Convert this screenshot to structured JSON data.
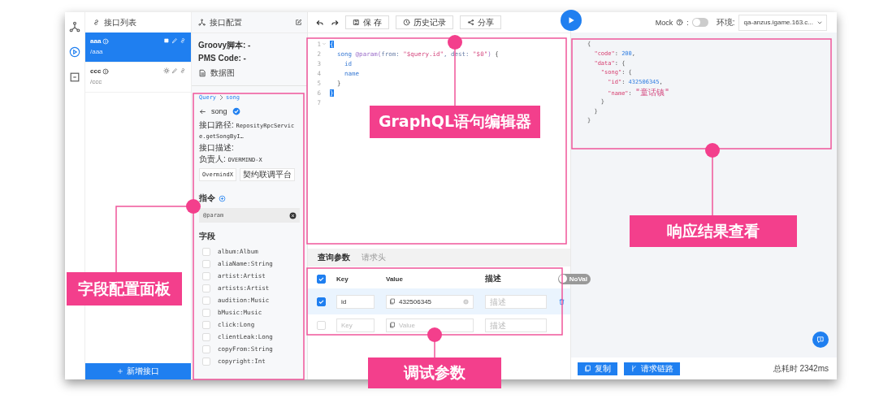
{
  "nav_rail": {
    "items": [
      {
        "kind": "graph",
        "selected": false
      },
      {
        "kind": "play",
        "selected": true
      },
      {
        "kind": "doc",
        "selected": false
      }
    ]
  },
  "interface_list": {
    "title": "接口列表",
    "items": [
      {
        "name": "aaa",
        "path": "/aaa",
        "kind": "square",
        "selected": true
      },
      {
        "name": "ccc",
        "path": "/ccc",
        "kind": "bug",
        "selected": false
      }
    ],
    "add_button": "新增接口"
  },
  "config_panel": {
    "title": "接口配置",
    "info_lines": [
      "Groovy脚本: -",
      "PMS Code: -"
    ],
    "data_graph": "数据图"
  },
  "field_panel": {
    "breadcrumb": [
      "Query",
      "song"
    ],
    "type_name": "song",
    "info": [
      {
        "label": "接口路径:",
        "value": "ReposityRpcService.getSongByI…"
      },
      {
        "label": "接口描述:"
      },
      {
        "label": "负责人:",
        "value": "OVERMIND-X"
      }
    ],
    "tags": [
      "OvermindX",
      "契约联调平台"
    ],
    "directives_title": "指令",
    "directive": "@param",
    "fields_title": "字段",
    "fields": [
      {
        "name": "album:Album",
        "checked": false
      },
      {
        "name": "aliaName:String",
        "checked": false
      },
      {
        "name": "artist:Artist",
        "checked": false
      },
      {
        "name": "artists:Artist",
        "checked": false
      },
      {
        "name": "audition:Music",
        "checked": false
      },
      {
        "name": "bMusic:Music",
        "checked": false
      },
      {
        "name": "click:Long",
        "checked": false
      },
      {
        "name": "clientLeak:Long",
        "checked": false
      },
      {
        "name": "copyFrom:String",
        "checked": false
      },
      {
        "name": "copyright:Int",
        "checked": false
      }
    ]
  },
  "toolbar": {
    "buttons": [
      {
        "kind": "save",
        "label": "保 存"
      },
      {
        "kind": "history",
        "label": "历史记录"
      },
      {
        "kind": "share",
        "label": "分享"
      }
    ]
  },
  "editor": {
    "lines": [
      {
        "number": "1",
        "fold": true,
        "tokens": [
          {
            "kind": "bracket",
            "text": "{"
          }
        ]
      },
      {
        "number": "2",
        "fold": false,
        "tokens": [
          {
            "kind": "field",
            "text": "  song "
          },
          {
            "kind": "directive",
            "text": "@param("
          },
          {
            "kind": "argument",
            "text": "from: "
          },
          {
            "kind": "string",
            "text": "\"$query.id\""
          },
          {
            "kind": "argument",
            "text": ", dest: "
          },
          {
            "kind": "string",
            "text": "\"$0\""
          },
          {
            "kind": "directive",
            "text": ") "
          },
          {
            "kind": "punct",
            "text": "{"
          }
        ]
      },
      {
        "number": "3",
        "fold": false,
        "tokens": [
          {
            "kind": "field",
            "text": "    id"
          }
        ]
      },
      {
        "number": "4",
        "fold": false,
        "tokens": [
          {
            "kind": "field",
            "text": "    name"
          }
        ]
      },
      {
        "number": "5",
        "fold": false,
        "tokens": [
          {
            "kind": "punct",
            "text": "  }"
          }
        ]
      },
      {
        "number": "6",
        "fold": false,
        "tokens": [
          {
            "kind": "bracket",
            "text": "}"
          }
        ]
      },
      {
        "number": "7",
        "fold": false
      }
    ]
  },
  "params": {
    "tabs": [
      {
        "label": "查询参数",
        "selected": true
      },
      {
        "label": "请求头",
        "selected": false
      }
    ],
    "all_checked": true,
    "columns": [
      "Key",
      "Value",
      "描述"
    ],
    "no_value_toggle": {
      "label": "NoVal",
      "on": false
    },
    "rows": [
      {
        "checked": true,
        "selected": true,
        "key": "id",
        "value": "432506345",
        "description_placeholder": "描述"
      },
      {
        "checked": false,
        "selected": false,
        "key_placeholder": "Key",
        "value_placeholder": "Value",
        "description_placeholder": "描述"
      }
    ]
  },
  "mock": {
    "label": "Mock",
    "separator": ":",
    "on": false
  },
  "environment": {
    "label": "环境:",
    "value": "qa-anzus.igame.163.c..."
  },
  "response": {
    "lines": [
      [
        {
          "kind": "punct",
          "text": "{"
        }
      ],
      [
        {
          "kind": "key",
          "text": "  \"code\""
        },
        {
          "kind": "punct",
          "text": ": "
        },
        {
          "kind": "number",
          "text": "200"
        },
        {
          "kind": "punct",
          "text": ","
        }
      ],
      [
        {
          "kind": "key",
          "text": "  \"data\""
        },
        {
          "kind": "punct",
          "text": ": {"
        }
      ],
      [
        {
          "kind": "key",
          "text": "    \"song\""
        },
        {
          "kind": "punct",
          "text": ": {"
        }
      ],
      [
        {
          "kind": "key",
          "text": "      \"id\""
        },
        {
          "kind": "punct",
          "text": ": "
        },
        {
          "kind": "number",
          "text": "432506345"
        },
        {
          "kind": "punct",
          "text": ","
        }
      ],
      [
        {
          "kind": "key",
          "text": "      \"name\""
        },
        {
          "kind": "punct",
          "text": ": "
        },
        {
          "kind": "string",
          "text": "\"童话镇\""
        }
      ],
      [
        {
          "kind": "punct",
          "text": "    }"
        }
      ],
      [
        {
          "kind": "punct",
          "text": "  }"
        }
      ],
      [
        {
          "kind": "punct",
          "text": "}"
        }
      ]
    ]
  },
  "footer": {
    "buttons": [
      {
        "kind": "copy",
        "label": "复制"
      },
      {
        "kind": "trace",
        "label": "请求链路"
      }
    ],
    "elapsed": "总耗时 2342ms"
  },
  "annotations": [
    {
      "label": "GraphQL语句编辑器"
    },
    {
      "label": "字段配置面板"
    },
    {
      "label": "调试参数"
    },
    {
      "label": "响应结果查看"
    }
  ]
}
